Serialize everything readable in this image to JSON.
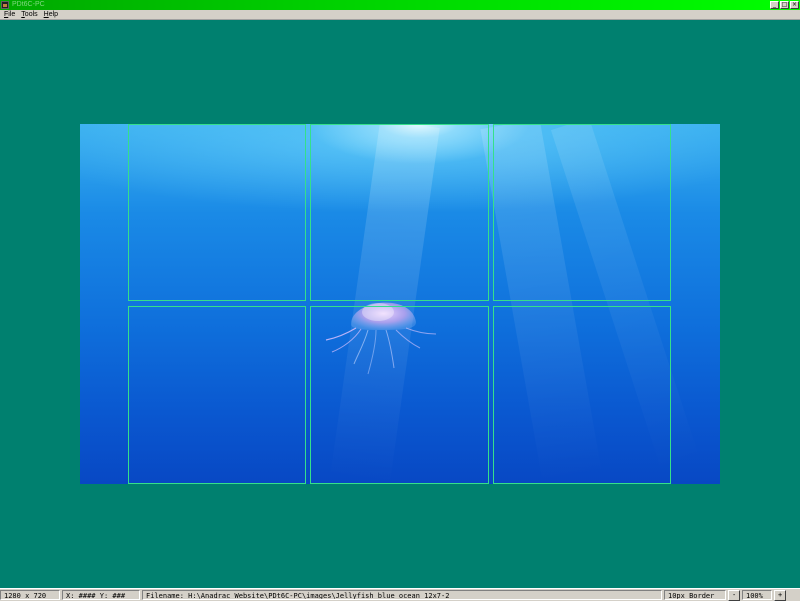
{
  "window": {
    "title": "PDt6C-PC",
    "controls": {
      "minimize": "_",
      "maximize": "□",
      "close": "×"
    }
  },
  "menu": {
    "items": [
      "File",
      "Tools",
      "Help"
    ]
  },
  "statusbar": {
    "dimensions": "1280 x 720",
    "coords_label_x": "X:",
    "coords_value_x": "####",
    "coords_label_y": "Y:",
    "coords_value_y": "###",
    "filename_label": "Filename:",
    "filename_value": "H:\\Anadrac Website\\PDt6C-PC\\images\\Jellyfish_blue_ocean_12x7-2",
    "border_mode": "10px Border",
    "zoom_out_label": "-",
    "zoom_level": "100%",
    "zoom_in_label": "+"
  },
  "colors": {
    "workspace_bg": "#00806f",
    "grid_line": "#35e08a",
    "titlebar_start": "#00a800",
    "titlebar_end": "#00ff00"
  },
  "icons": {
    "app": "app-icon",
    "minimize": "minimize-icon",
    "maximize": "maximize-icon",
    "close": "close-icon"
  }
}
